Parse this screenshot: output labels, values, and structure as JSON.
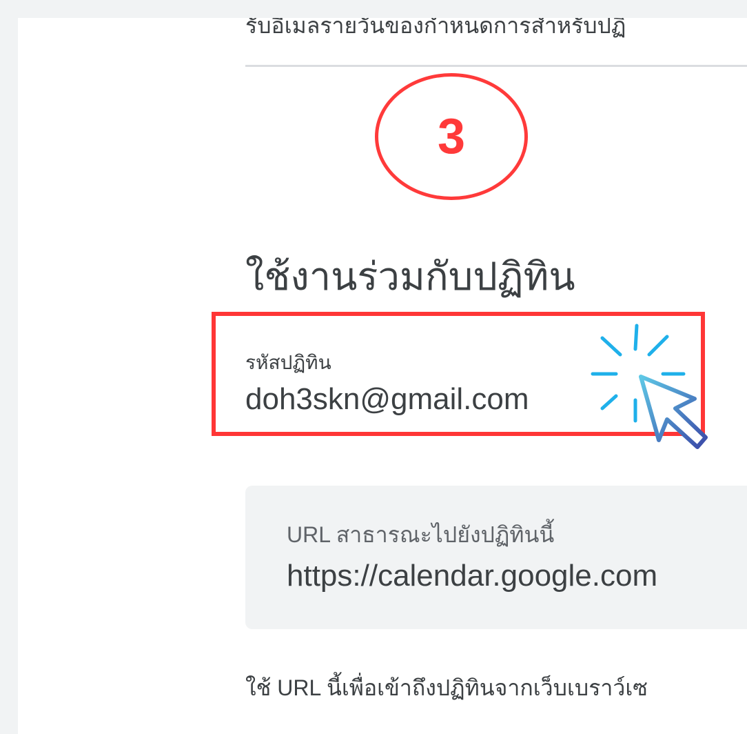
{
  "header": {
    "truncated_text": "รับอีเมลรายวันของกำหนดการสำหรับปฏิ"
  },
  "step_badge": {
    "number": "3",
    "color": "#ff3a3a"
  },
  "calendar_integration": {
    "title": "ใช้งานร่วมกับปฏิทิน",
    "calendar_id": {
      "label": "รหัสปฏิทิน",
      "value": "doh3skn@gmail.com"
    },
    "public_url": {
      "label": "URL สาธารณะไปยังปฏิทินนี้",
      "value": "https://calendar.google.com"
    },
    "helper_text": "ใช้ URL นี้เพื่อเข้าถึงปฏิทินจากเว็บเบราว์เซ"
  },
  "highlight": {
    "box_color": "#ff3636",
    "cursor_icon": "click-cursor-icon"
  }
}
